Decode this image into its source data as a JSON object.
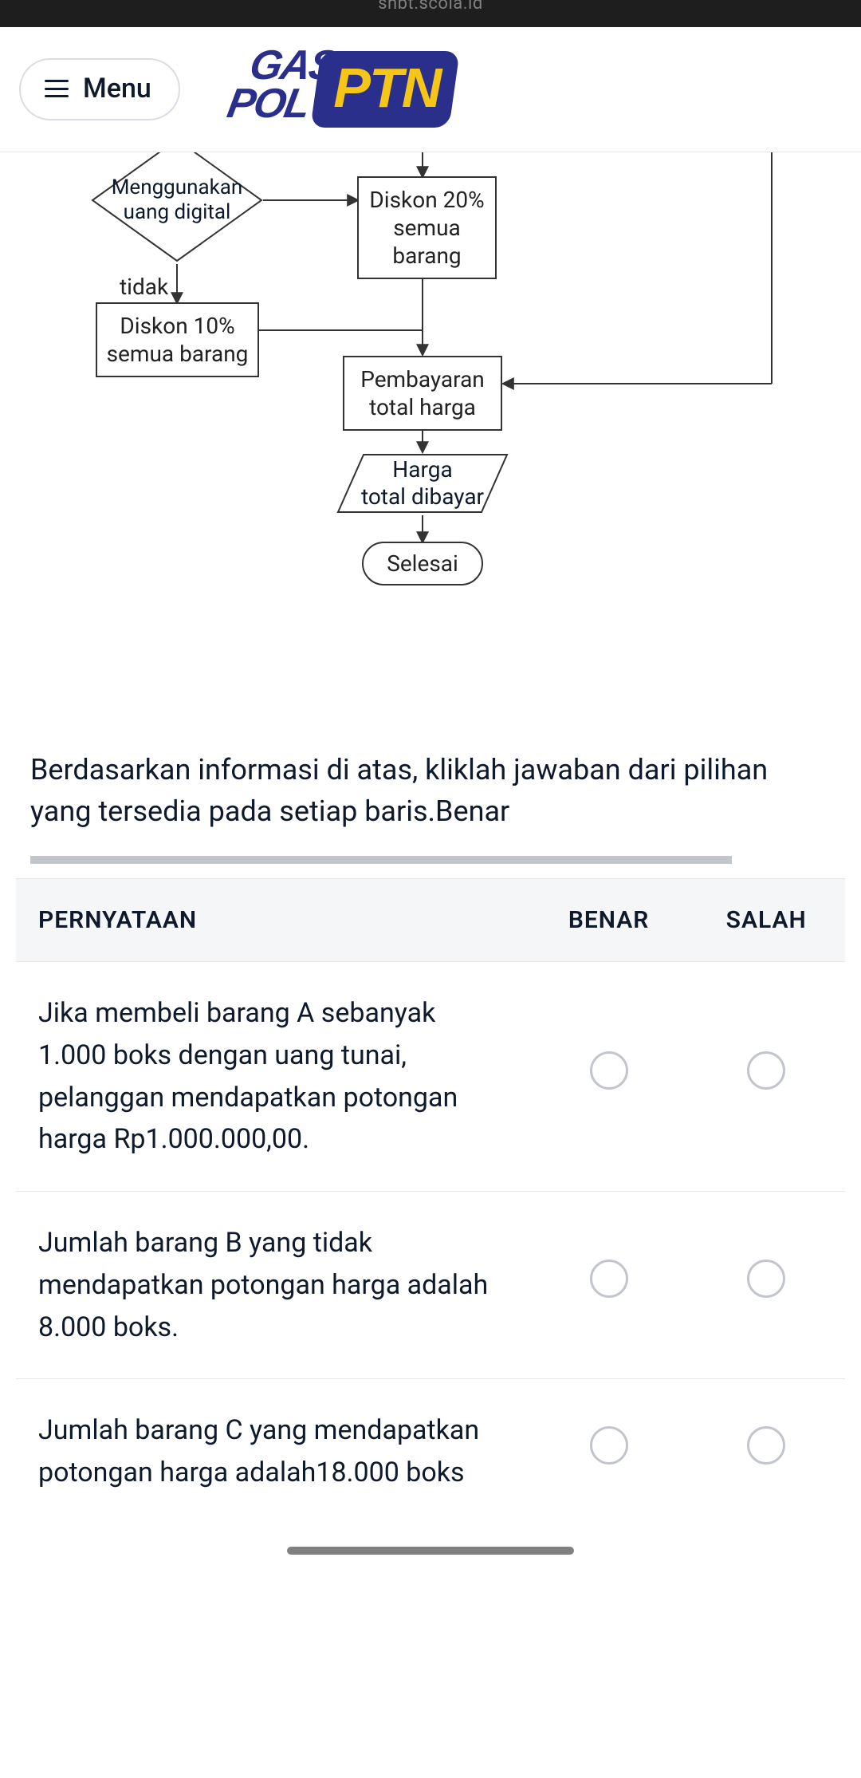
{
  "topbar": {
    "domain": "snbt.scola.id"
  },
  "header": {
    "menu_label": "Menu",
    "logo": {
      "line1": "GAS",
      "line2": "POL",
      "badge": "PTN"
    }
  },
  "flowchart": {
    "decision_digital": "Menggunakan\nuang digital",
    "label_no": "tidak",
    "discount_10": "Diskon 10%\nsemua barang",
    "discount_20": "Diskon 20%\nsemua barang",
    "payment_total": "Pembayaran\ntotal harga",
    "price_paid": "Harga\ntotal dibayar",
    "end": "Selesai"
  },
  "question": "Berdasarkan informasi di atas, kliklah jawaban dari pilihan yang tersedia pada setiap baris.Benar",
  "table": {
    "headers": {
      "statement": "PERNYATAAN",
      "true": "BENAR",
      "false": "SALAH"
    },
    "rows": [
      {
        "statement": "Jika membeli barang A sebanyak 1.000 boks dengan uang tunai, pelanggan mendapatkan potongan harga Rp1.000.000,00."
      },
      {
        "statement": "Jumlah barang B yang tidak mendapatkan potongan harga adalah 8.000 boks."
      },
      {
        "statement": "Jumlah barang C yang mendapatkan potongan harga adalah18.000 boks"
      }
    ]
  }
}
